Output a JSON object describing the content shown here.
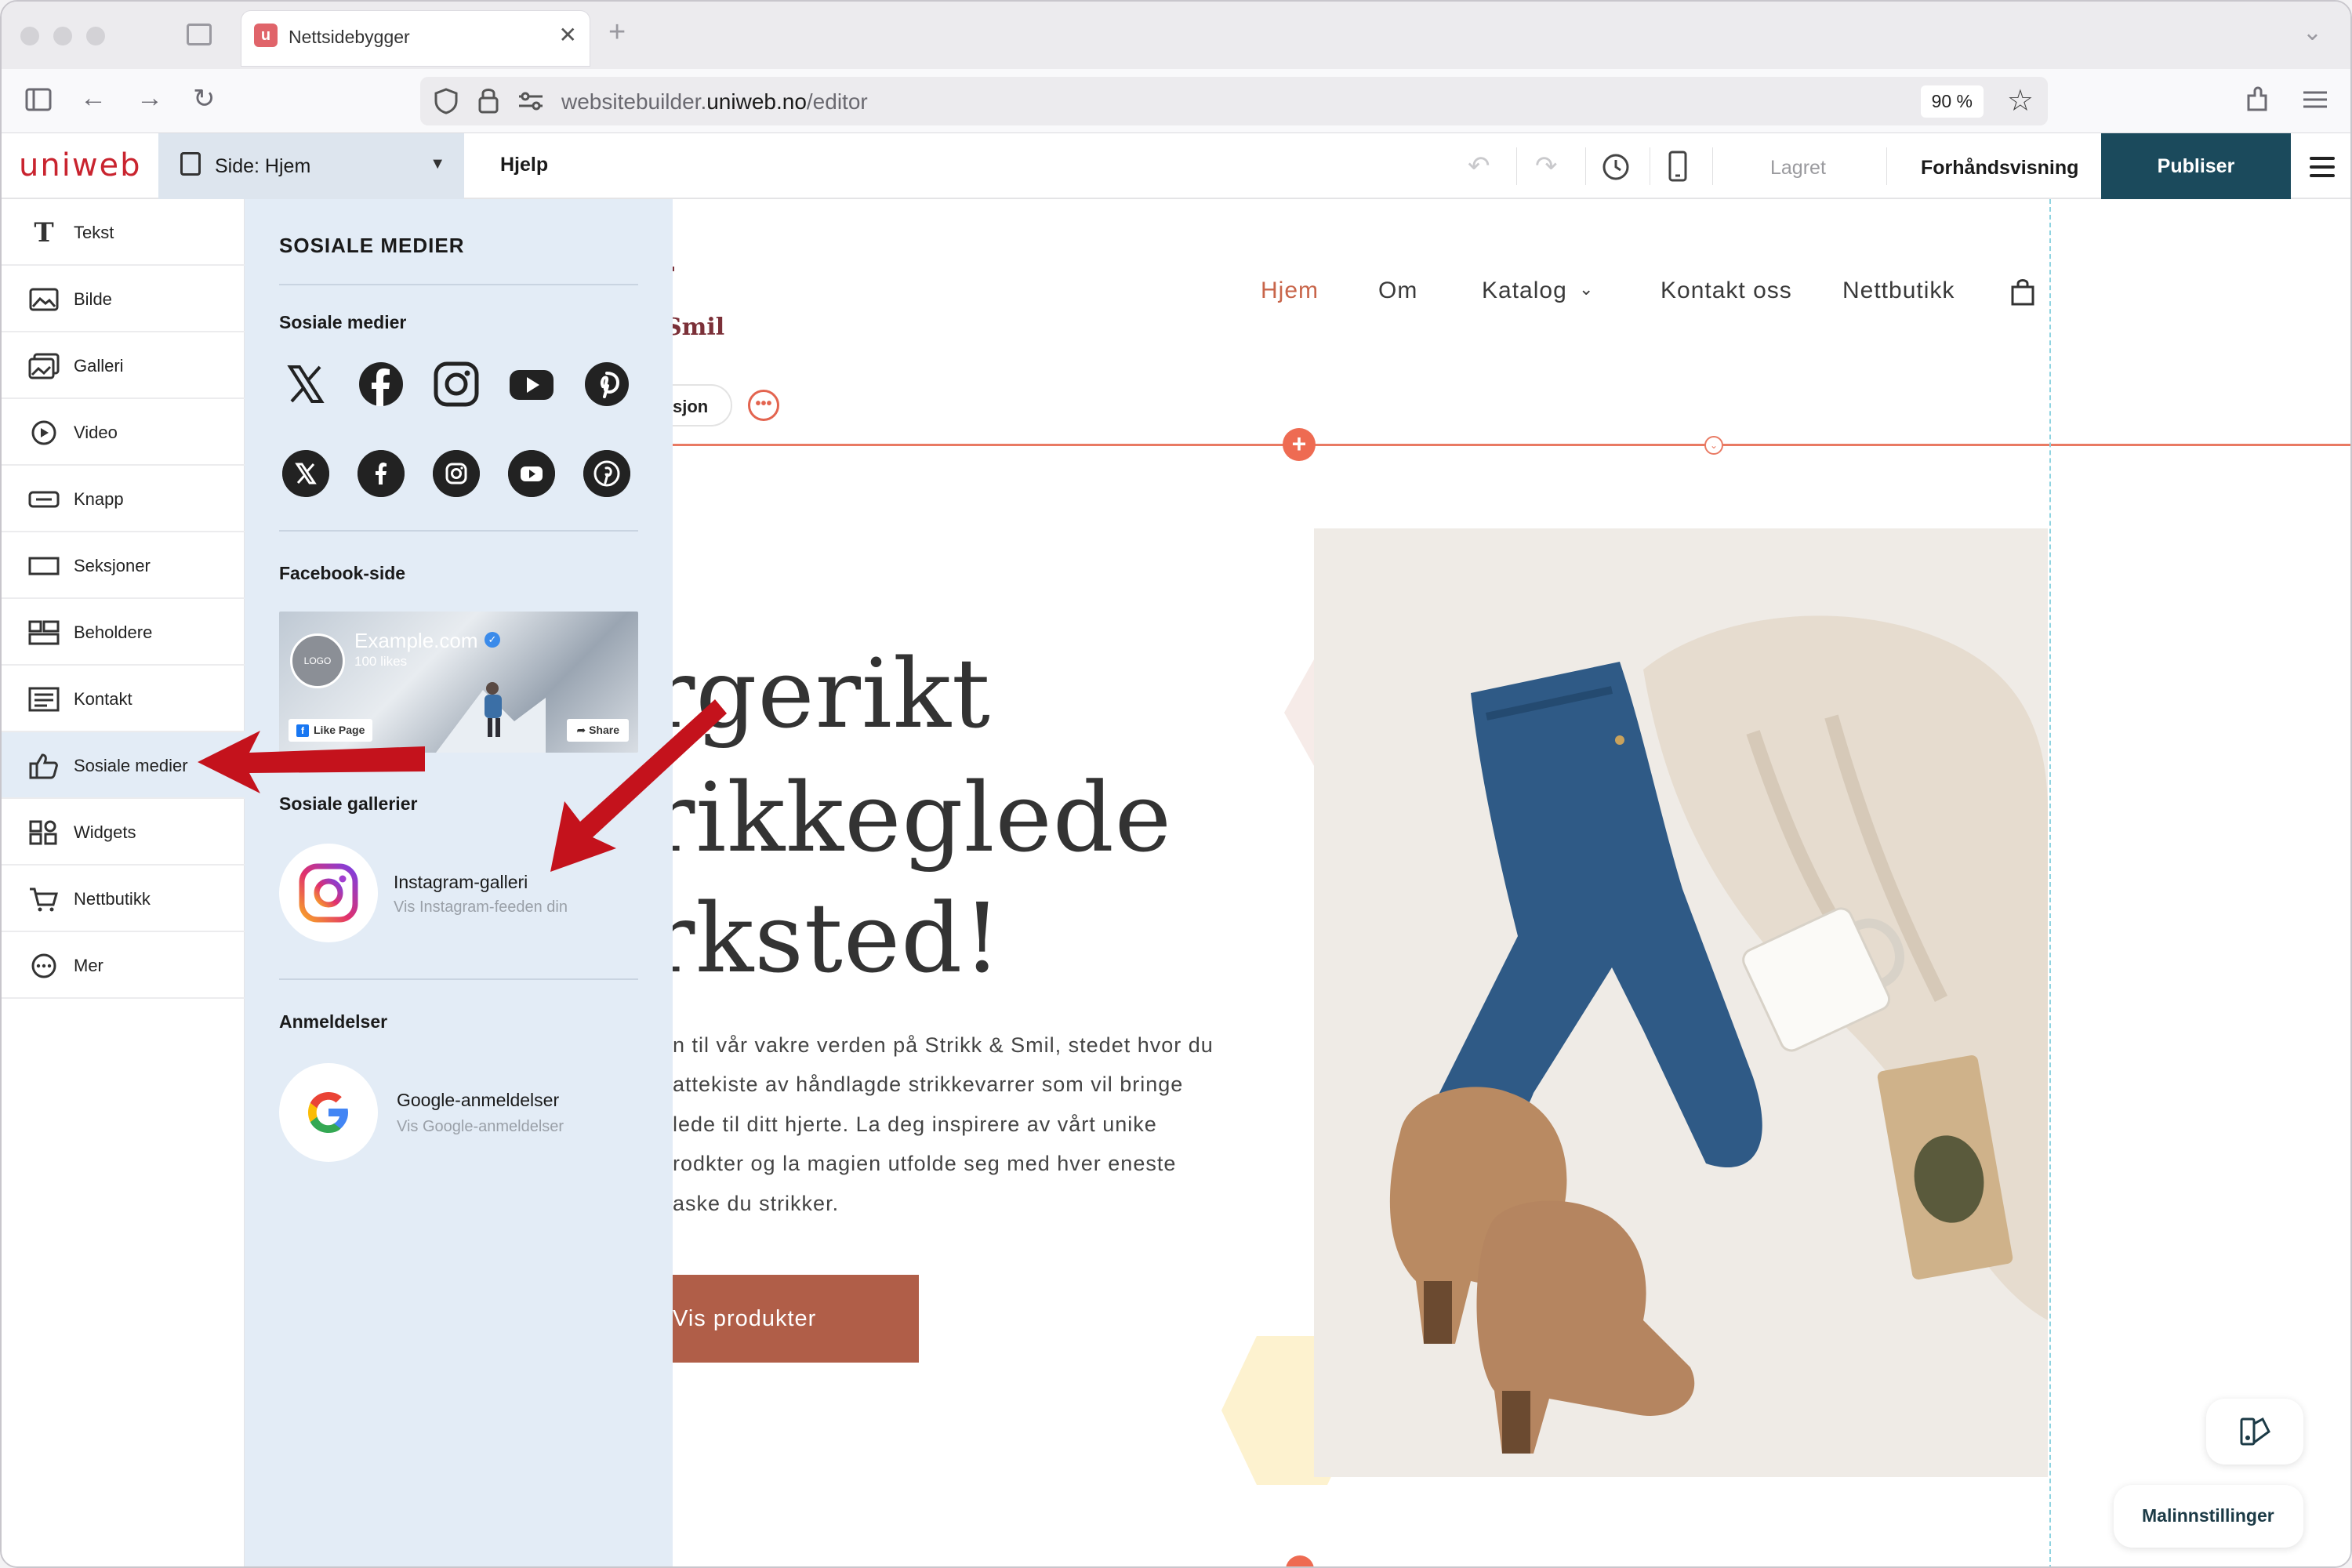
{
  "browser": {
    "tab_title": "Nettsidebygger",
    "url_host": "websitebuilder.",
    "url_domain": "uniweb.no",
    "url_path": "/editor",
    "zoom": "90 %"
  },
  "editor": {
    "logo": "uniweb",
    "page_select": "Side: Hjem",
    "help": "Hjelp",
    "saved": "Lagret",
    "preview": "Forhåndsvisning",
    "publish": "Publiser"
  },
  "sidebar": {
    "items": [
      {
        "label": "Tekst",
        "icon": "text-icon"
      },
      {
        "label": "Bilde",
        "icon": "image-icon"
      },
      {
        "label": "Galleri",
        "icon": "gallery-icon"
      },
      {
        "label": "Video",
        "icon": "video-icon"
      },
      {
        "label": "Knapp",
        "icon": "button-icon"
      },
      {
        "label": "Seksjoner",
        "icon": "sections-icon"
      },
      {
        "label": "Beholdere",
        "icon": "containers-icon"
      },
      {
        "label": "Kontakt",
        "icon": "contact-icon"
      },
      {
        "label": "Sosiale medier",
        "icon": "thumbs-up-icon"
      },
      {
        "label": "Widgets",
        "icon": "widgets-icon"
      },
      {
        "label": "Nettbutikk",
        "icon": "cart-icon"
      },
      {
        "label": "Mer",
        "icon": "more-icon"
      }
    ]
  },
  "panel": {
    "title": "SOSIALE MEDIER",
    "social_section": "Sosiale medier",
    "facebook_section": "Facebook-side",
    "facebook_card": {
      "logo": "LOGO",
      "name": "Example.com",
      "likes": "100 likes",
      "like_button": "Like Page",
      "share_button": "Share"
    },
    "galleries_section": "Sosiale gallerier",
    "instagram": {
      "title": "Instagram-galleri",
      "subtitle": "Vis Instagram-feeden din"
    },
    "reviews_section": "Anmeldelser",
    "google": {
      "title": "Google-anmeldelser",
      "subtitle": "Vis Google-anmeldelser"
    }
  },
  "site": {
    "nav": [
      "Hjem",
      "Om",
      "Katalog",
      "Kontakt oss",
      "Nettbutikk"
    ],
    "brand_fragment": "Smil",
    "section_pill": "sjon",
    "hero_lines": [
      "rgerikt",
      "rikkeglede",
      "rksted!"
    ],
    "body_lines": [
      "n til vår vakre verden på Strikk & Smil, stedet hvor du",
      "attekiste av håndlagde strikkevarrer som vil bringe",
      "lede til ditt hjerte. La deg inspirere av vårt unike",
      "rodkter og la magien utfolde seg med hver eneste",
      "aske du strikker."
    ],
    "cta": "Vis produkter",
    "template_settings": "Malinnstillinger"
  }
}
